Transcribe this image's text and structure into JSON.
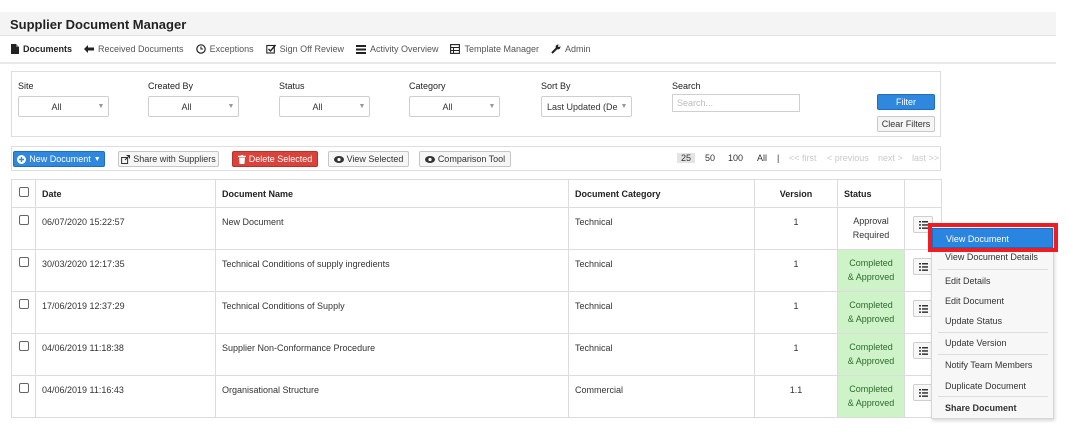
{
  "app": {
    "title": "Supplier Document Manager"
  },
  "nav": [
    {
      "label": "Documents",
      "icon": "document-icon",
      "active": true
    },
    {
      "label": "Received Documents",
      "icon": "arrow-left-icon"
    },
    {
      "label": "Exceptions",
      "icon": "clock-icon"
    },
    {
      "label": "Sign Off Review",
      "icon": "check-square-icon"
    },
    {
      "label": "Activity Overview",
      "icon": "list-icon"
    },
    {
      "label": "Template Manager",
      "icon": "table-icon"
    },
    {
      "label": "Admin",
      "icon": "wrench-icon"
    }
  ],
  "filters": {
    "site_label": "Site",
    "site_value": "All",
    "created_by_label": "Created By",
    "created_by_value": "All",
    "status_label": "Status",
    "status_value": "All",
    "category_label": "Category",
    "category_value": "All",
    "sort_by_label": "Sort By",
    "sort_by_value": "Last Updated (Desc",
    "search_label": "Search",
    "search_placeholder": "Search...",
    "filter_button": "Filter",
    "clear_button": "Clear Filters"
  },
  "toolbar": {
    "new_document": "New Document",
    "share": "Share with Suppliers",
    "delete": "Delete Selected",
    "view_selected": "View Selected",
    "comparison": "Comparison Tool",
    "page_sizes": [
      "25",
      "50",
      "100",
      "All"
    ],
    "active_page_size": "25",
    "separator": "|",
    "first": "<< first",
    "previous": "< previous",
    "next": "next >",
    "last": "last >>"
  },
  "table": {
    "headers": {
      "date": "Date",
      "name": "Document Name",
      "category": "Document Category",
      "version": "Version",
      "status": "Status"
    },
    "rows": [
      {
        "date": "06/07/2020 15:22:57",
        "name": "New Document",
        "category": "Technical",
        "version": "1",
        "status_line1": "Approval",
        "status_line2": "Required",
        "completed": false
      },
      {
        "date": "30/03/2020 12:17:35",
        "name": "Technical Conditions of supply ingredients",
        "category": "Technical",
        "version": "1",
        "status_line1": "Completed",
        "status_line2": "& Approved",
        "completed": true
      },
      {
        "date": "17/06/2019 12:37:29",
        "name": "Technical Conditions of Supply",
        "category": "Technical",
        "version": "1",
        "status_line1": "Completed",
        "status_line2": "& Approved",
        "completed": true
      },
      {
        "date": "04/06/2019 11:18:38",
        "name": "Supplier Non-Conformance Procedure",
        "category": "Technical",
        "version": "1",
        "status_line1": "Completed",
        "status_line2": "& Approved",
        "completed": true
      },
      {
        "date": "04/06/2019 11:16:43",
        "name": "Organisational Structure",
        "category": "Commercial",
        "version": "1.1",
        "status_line1": "Completed",
        "status_line2": "& Approved",
        "completed": true
      }
    ]
  },
  "context_menu": {
    "items": [
      "View Document",
      "View Document Details",
      "Edit Details",
      "Edit Document",
      "Update Status",
      "Update Version",
      "Notify Team Members",
      "Duplicate Document",
      "Share Document"
    ],
    "selected": "View Document",
    "highlight_color": "#ee1d24"
  },
  "colors": {
    "primary": "#2f87de",
    "danger": "#d9433b",
    "completed_bg": "#cff3c9",
    "highlight": "#ee1d24"
  }
}
